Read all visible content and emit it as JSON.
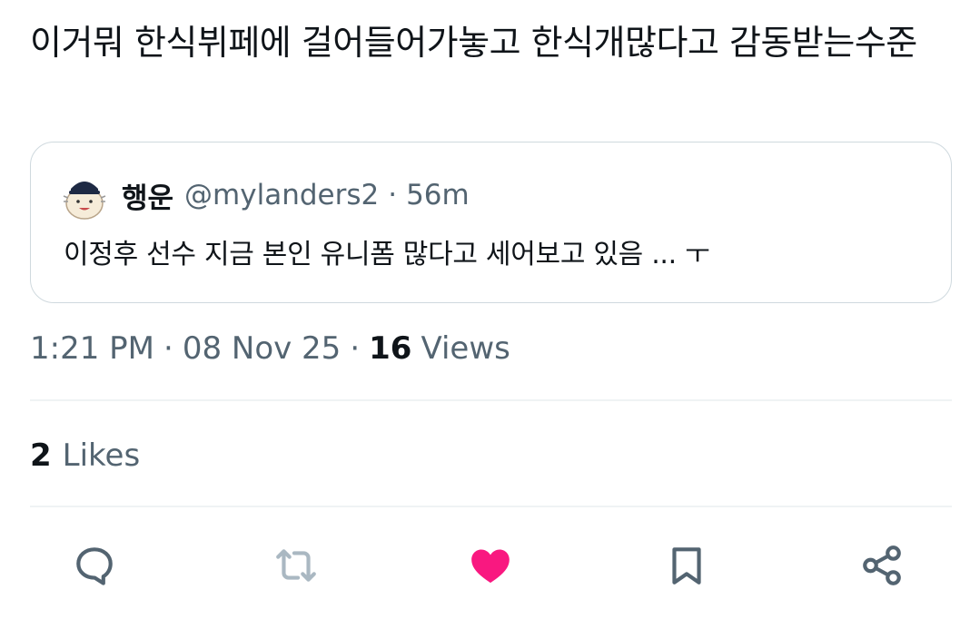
{
  "tweet": {
    "text": "이거뭐 한식뷔페에 걸어들어가놓고 한식개많다고 감동받는수준",
    "time": "1:21 PM",
    "date": "08 Nov 25",
    "separator": "·",
    "views_count": "16",
    "views_label": "Views",
    "likes_count": "2",
    "likes_label": "Likes"
  },
  "quote": {
    "name": "행운",
    "handle": "@mylanders2",
    "time": "56m",
    "text": "이정후 선수 지금 본인 유니폼 많다고 세어보고 있음 ... ㅜ"
  },
  "actions": {
    "reply_icon": "reply-icon",
    "retweet_icon": "retweet-icon",
    "like_icon": "heart-filled-icon",
    "bookmark_icon": "bookmark-icon",
    "share_icon": "share-icon"
  },
  "colors": {
    "text": "#0f1419",
    "secondary": "#536471",
    "border": "#cfd9de",
    "like": "#f91880",
    "icon": "#536471"
  }
}
